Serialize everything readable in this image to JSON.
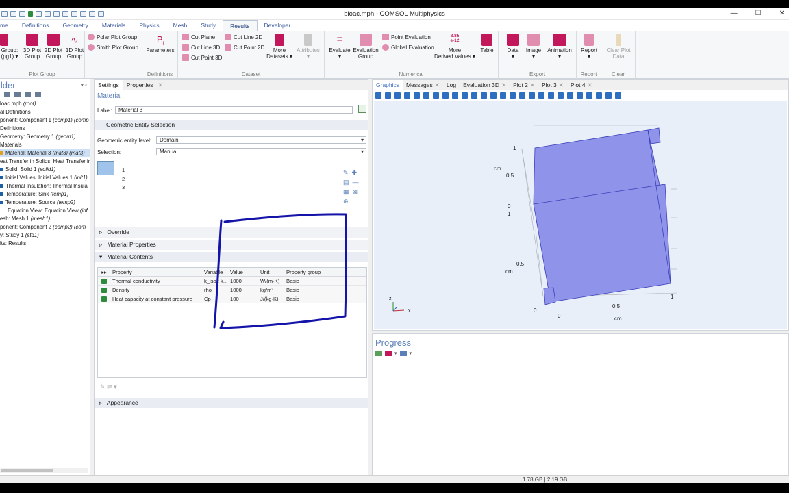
{
  "app": {
    "title": "bloac.mph - COMSOL Multiphysics",
    "window_controls": [
      "—",
      "☐",
      "✕"
    ]
  },
  "ribbon_tabs": [
    {
      "label": "me"
    },
    {
      "label": "Definitions"
    },
    {
      "label": "Geometry"
    },
    {
      "label": "Materials"
    },
    {
      "label": "Physics"
    },
    {
      "label": "Mesh"
    },
    {
      "label": "Study"
    },
    {
      "label": "Results",
      "active": true
    },
    {
      "label": "Developer"
    }
  ],
  "ribbon": {
    "plot_group": {
      "label": "Plot Group",
      "group_button": "Group:\n(pg1) ▾",
      "plot3d": "3D Plot\nGroup",
      "plot2d": "2D Plot\nGroup",
      "plot1d": "1D Plot\nGroup",
      "polar": "Polar Plot Group",
      "smith": "Smith Plot Group"
    },
    "definitions": {
      "label": "Definitions",
      "parameters": "Parameters"
    },
    "dataset": {
      "label": "Dataset",
      "cut_plane": "Cut Plane",
      "cut_line_3d": "Cut Line 3D",
      "cut_point_3d": "Cut Point 3D",
      "cut_line_2d": "Cut Line 2D",
      "cut_point_2d": "Cut Point 2D",
      "more_datasets": "More\nDatasets ▾",
      "attributes": "Attributes\n▾"
    },
    "numerical": {
      "label": "Numerical",
      "evaluate": "Evaluate\n▾",
      "evaluation_group": "Evaluation\nGroup",
      "point_evaluation": "Point Evaluation",
      "global_evaluation": "Global Evaluation",
      "more_derived": "More\nDerived Values ▾",
      "more_derived_icon": "8.85\ne-12",
      "table": "Table"
    },
    "export": {
      "label": "Export",
      "data": "Data\n▾",
      "image": "Image\n▾",
      "animation": "Animation\n▾"
    },
    "report": {
      "label": "Report",
      "report": "Report\n▾"
    },
    "clear": {
      "label": "Clear",
      "clear_plot_data": "Clear Plot\nData"
    }
  },
  "model_builder": {
    "title": "ilder",
    "tree": [
      {
        "text": "loac.mph",
        "tag": "(root)"
      },
      {
        "text": "al Definitions",
        "tag": ""
      },
      {
        "text": "ponent: Component 1",
        "tag": "(comp1) (comp"
      },
      {
        "text": "Definitions",
        "tag": ""
      },
      {
        "text": "Geometry: Geometry 1",
        "tag": "(geom1)"
      },
      {
        "text": "Materials",
        "tag": ""
      },
      {
        "text": "Material: Material 3",
        "tag": "(mat3) (mat3)",
        "selected": true
      },
      {
        "text": "eat Transfer in Solids: Heat Transfer in",
        "tag": ""
      },
      {
        "text": "Solid: Solid 1",
        "tag": "(solid1)"
      },
      {
        "text": "Initial Values: Initial Values 1",
        "tag": "(init1)"
      },
      {
        "text": "Thermal Insulation: Thermal Insula",
        "tag": ""
      },
      {
        "text": "Temperature: Sink",
        "tag": "(temp1)"
      },
      {
        "text": "Temperature: Source",
        "tag": "(temp2)"
      },
      {
        "text": "Equation View: Equation View",
        "tag": "(inf"
      },
      {
        "text": "esh: Mesh 1",
        "tag": "(mesh1)"
      },
      {
        "text": "ponent: Component 2",
        "tag": "(comp2) (com"
      },
      {
        "text": "y: Study 1",
        "tag": "(std1)"
      },
      {
        "text": "lts: Results",
        "tag": ""
      }
    ]
  },
  "settings": {
    "tabs": [
      "Settings",
      "Properties"
    ],
    "heading": "Material",
    "label_caption": "Label:",
    "label_value": "Material 3",
    "geometric_entity_section": "Geometric Entity Selection",
    "entity_level_caption": "Geometric entity level:",
    "entity_level_value": "Domain",
    "selection_caption": "Selection:",
    "selection_value": "Manual",
    "selection_items": [
      "1",
      "2",
      "3"
    ],
    "sections": {
      "override": "Override",
      "material_properties": "Material Properties",
      "material_contents": "Material Contents",
      "appearance": "Appearance"
    },
    "table": {
      "columns": [
        "Property",
        "Variable",
        "Value",
        "Unit",
        "Property group"
      ],
      "rows": [
        {
          "property": "Thermal conductivity",
          "variable": "k_iso ; k...",
          "value": "1000",
          "unit": "W/(m·K)",
          "group": "Basic"
        },
        {
          "property": "Density",
          "variable": "rho",
          "value": "1000",
          "unit": "kg/m³",
          "group": "Basic"
        },
        {
          "property": "Heat capacity at constant pressure",
          "variable": "Cp",
          "value": "100",
          "unit": "J/(kg·K)",
          "group": "Basic"
        }
      ]
    }
  },
  "graphics": {
    "tabs": [
      "Graphics",
      "Messages",
      "Log",
      "Evaluation 3D",
      "Plot 2",
      "Plot 3",
      "Plot 4"
    ],
    "axis_labels": {
      "top_1": "1",
      "cm_top": "cm",
      "top_05": "0.5",
      "top_0": "0",
      "mid_1": "1",
      "mid_05": "0.5",
      "cm_mid": "cm",
      "bot_0": "0",
      "bx_0": "0",
      "bx_05": "0.5",
      "bx_1": "1",
      "cm_bottom": "cm"
    },
    "triad": {
      "z": "z",
      "x": "x"
    },
    "colors": {
      "body": "#8f93ea",
      "background": "#e8eff9",
      "annotation": "#1414a8"
    }
  },
  "progress": {
    "title": "Progress"
  },
  "statusbar": {
    "memory": "1.78 GB | 2.19 GB"
  }
}
